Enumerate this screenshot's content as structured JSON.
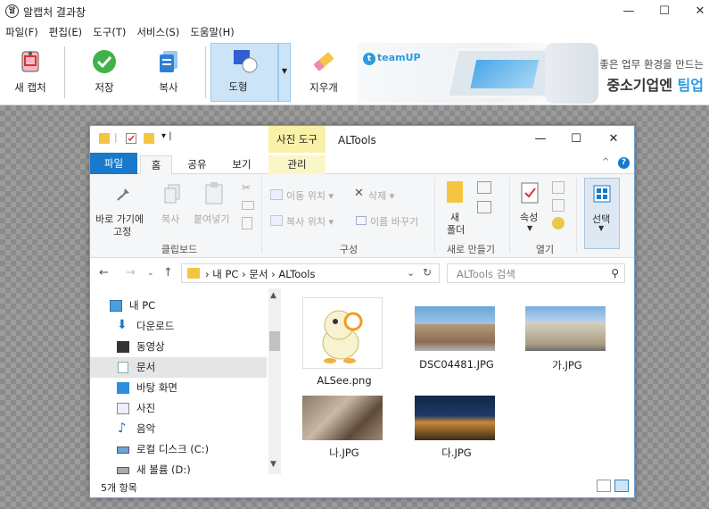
{
  "app": {
    "title": "알캡처 결과창",
    "logo_text": "알",
    "menus": [
      "파일(F)",
      "편집(E)",
      "도구(T)",
      "서비스(S)",
      "도움말(H)"
    ],
    "toolbar": [
      {
        "label": "새 캡처",
        "icon": "new-capture-icon"
      },
      {
        "label": "저장",
        "icon": "save-check-icon"
      },
      {
        "label": "복사",
        "icon": "copy-icon"
      },
      {
        "label": "도형",
        "icon": "shape-icon"
      },
      {
        "label": "지우개",
        "icon": "eraser-icon"
      }
    ],
    "banner": {
      "brand": "teamUP",
      "line1": "좋은 업무 환경을 만드는",
      "line2": "중소기업엔",
      "line2_accent": "팀업"
    },
    "window_controls": {
      "minimize": "—",
      "maximize": "☐",
      "close": "✕"
    }
  },
  "explorer": {
    "context_tab": "사진 도구",
    "title": "ALTools",
    "tabs": [
      "파일",
      "홈",
      "공유",
      "보기",
      "관리"
    ],
    "ribbon": {
      "pin_label": "바로 가기에",
      "pin_label2": "고정",
      "copy": "복사",
      "paste": "붙여넣기",
      "group_clipboard": "클립보드",
      "move_to": "이동 위치",
      "copy_to": "복사 위치",
      "delete": "삭제",
      "rename": "이름 바꾸기",
      "group_organize": "구성",
      "new_folder": "새",
      "new_folder2": "폴더",
      "group_new": "새로 만들기",
      "properties": "속성",
      "group_open": "열기",
      "select": "선택"
    },
    "address": {
      "crumbs": "›  내 PC  ›  문서  ›  ALTools",
      "search_placeholder": "ALTools 검색"
    },
    "nav": [
      {
        "label": "내 PC",
        "icon": "pc-icon"
      },
      {
        "label": "다운로드",
        "icon": "download-icon"
      },
      {
        "label": "동영상",
        "icon": "video-icon"
      },
      {
        "label": "문서",
        "icon": "document-icon"
      },
      {
        "label": "바탕 화면",
        "icon": "desktop-icon"
      },
      {
        "label": "사진",
        "icon": "picture-icon"
      },
      {
        "label": "음악",
        "icon": "music-icon"
      },
      {
        "label": "로컬 디스크 (C:)",
        "icon": "disk-icon"
      },
      {
        "label": "새 볼륨 (D:)",
        "icon": "volume-icon"
      }
    ],
    "files": [
      {
        "name": "ALSee.png"
      },
      {
        "name": "DSC04481.JPG"
      },
      {
        "name": "가.JPG"
      },
      {
        "name": "나.JPG"
      },
      {
        "name": "다.JPG"
      }
    ],
    "status": "5개 항목"
  }
}
